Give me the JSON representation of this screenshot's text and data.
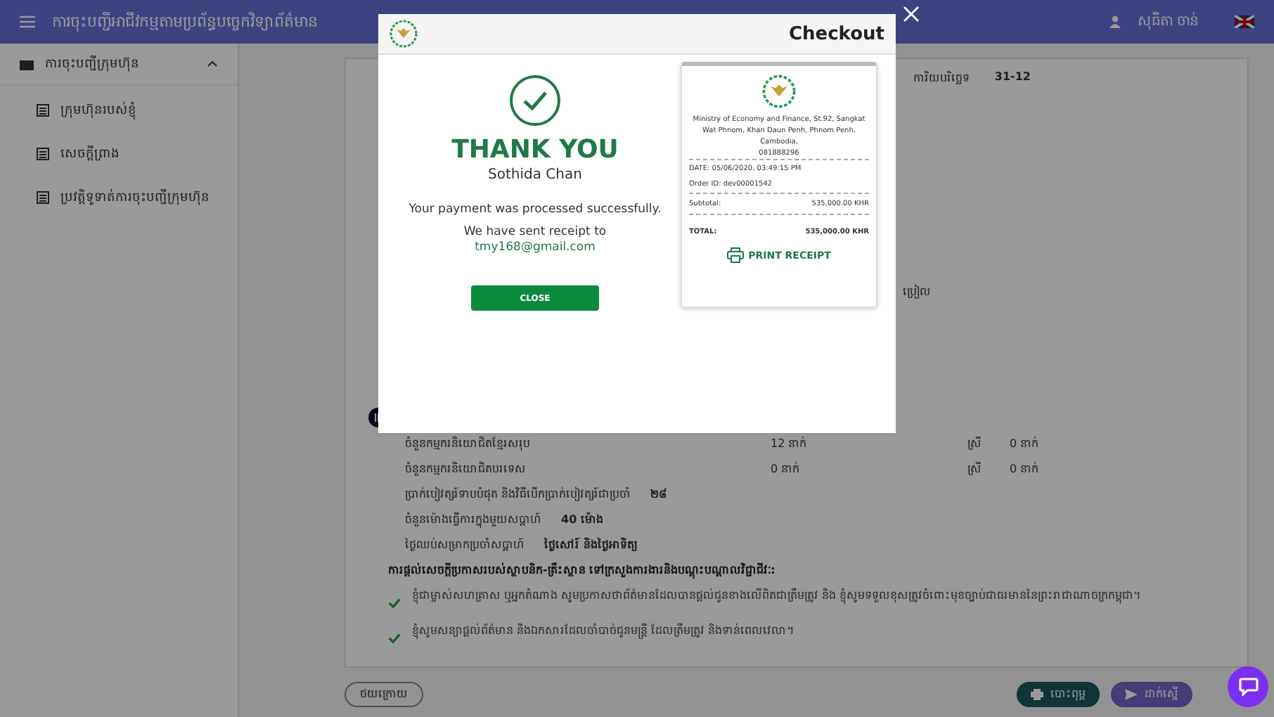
{
  "header": {
    "title": "ការចុះបញ្ជីអាជីវកម្មតាមប្រព័ន្ធបច្ចេកវិទ្យាព័ត៌មាន",
    "user": "សុធីតា ចាន់"
  },
  "sidebar": {
    "group": {
      "label": "ការចុះបញ្ជីក្រុមហ៊ុន",
      "expanded": true,
      "items": [
        {
          "label": "ក្រុមហ៊ុនរបស់ខ្ញុំ"
        },
        {
          "label": "សេចក្តីព្រាង"
        },
        {
          "label": "ប្រវត្តិទូទាត់ការចុះបញ្ជីក្រុមហ៊ុន"
        }
      ]
    }
  },
  "form": {
    "top_field": {
      "label": "ការិយបរិច្ឆេទ",
      "value": "31-12"
    },
    "side_text": "ប្រៀល",
    "rows": [
      {
        "label": "ចំនួនកម្មករនិយោជិតខ្មែរសរុប",
        "value": "12 នាក់",
        "extra_label": "ស្រី",
        "extra_value": "0 នាក់"
      },
      {
        "label": "ចំនួនកម្មករនិយោជិតបរទេស",
        "value": "0 នាក់",
        "extra_label": "ស្រី",
        "extra_value": "0 នាក់"
      },
      {
        "label": "ប្រាក់បៀវត្សរ៍ទាបបំផុត និងវិធីបើកប្រាក់បៀវត្សរ៍ជាប្រចាំ",
        "value": "២៨"
      },
      {
        "label": "ចំនួនម៉ោងធ្វើការក្នុងមួយសប្តាហ៍",
        "value": "40 ម៉ោង"
      },
      {
        "label": "ថ្ងៃឈប់សម្រាកប្រចាំសប្តាហ៍",
        "value": "ថ្ងៃសៅរ៍ និងថ្ងៃអាទិត្យ"
      }
    ],
    "declaration": {
      "heading": "ការផ្តល់សេចក្តីប្រកាសរបស់ស្ថាបនិក-គ្រឹះស្ថាន ទៅក្រសួងការងារនិងបណ្តុះបណ្តាលវិជ្ជាជីវៈ:",
      "items": [
        {
          "text": "ខ្ញុំជាម្ចាស់សហគ្រាស ឬអ្នកតំណាង សូមប្រកាសថាព័ត៌មានដែលបានផ្តល់ជូនខាងលើពិតជាត្រឹមត្រូវ និង ខ្ញុំសូមទទួលខុសត្រូវចំពោះមុខច្បាប់ជាធរមាននៃព្រះរាជាណាចក្រកម្ពុជា។",
          "checked": true
        },
        {
          "text": "ខ្ញុំសូមសន្យាផ្តល់ព័ត៌មាន និងឯកសារដែលចាំបាច់ជូនមន្ត្រី ដែលត្រឹមត្រូវ និងទាន់ពេលវេលា។",
          "checked": true
        }
      ]
    }
  },
  "buttons": {
    "back": "ថយក្រោយ",
    "print": "បោះពុម្ព",
    "submit": "ដាក់ស្នើ"
  },
  "modal": {
    "title": "Checkout",
    "heading": "THANK YOU",
    "name": "Sothida Chan",
    "message": "Your payment was processed successfully.",
    "receipt_note": "We have sent receipt to",
    "email": "tmy168@gmail.com",
    "close": "CLOSE",
    "receipt": {
      "address": "Ministry of Economy and Finance, St.92, Sangkat Wat Phnom, Khan Daun Penh, Phnom Penh, Cambodia,",
      "phone": "081888296",
      "date": "DATE: 05/06/2020, 03:49:15 PM",
      "order": "Order ID: dev00001542",
      "subtotal_label": "Subtotal:",
      "subtotal": "535,000.00 KHR",
      "total_label": "TOTAL:",
      "total": "535,000.00 KHR",
      "print": "PRINT RECEIPT"
    }
  }
}
